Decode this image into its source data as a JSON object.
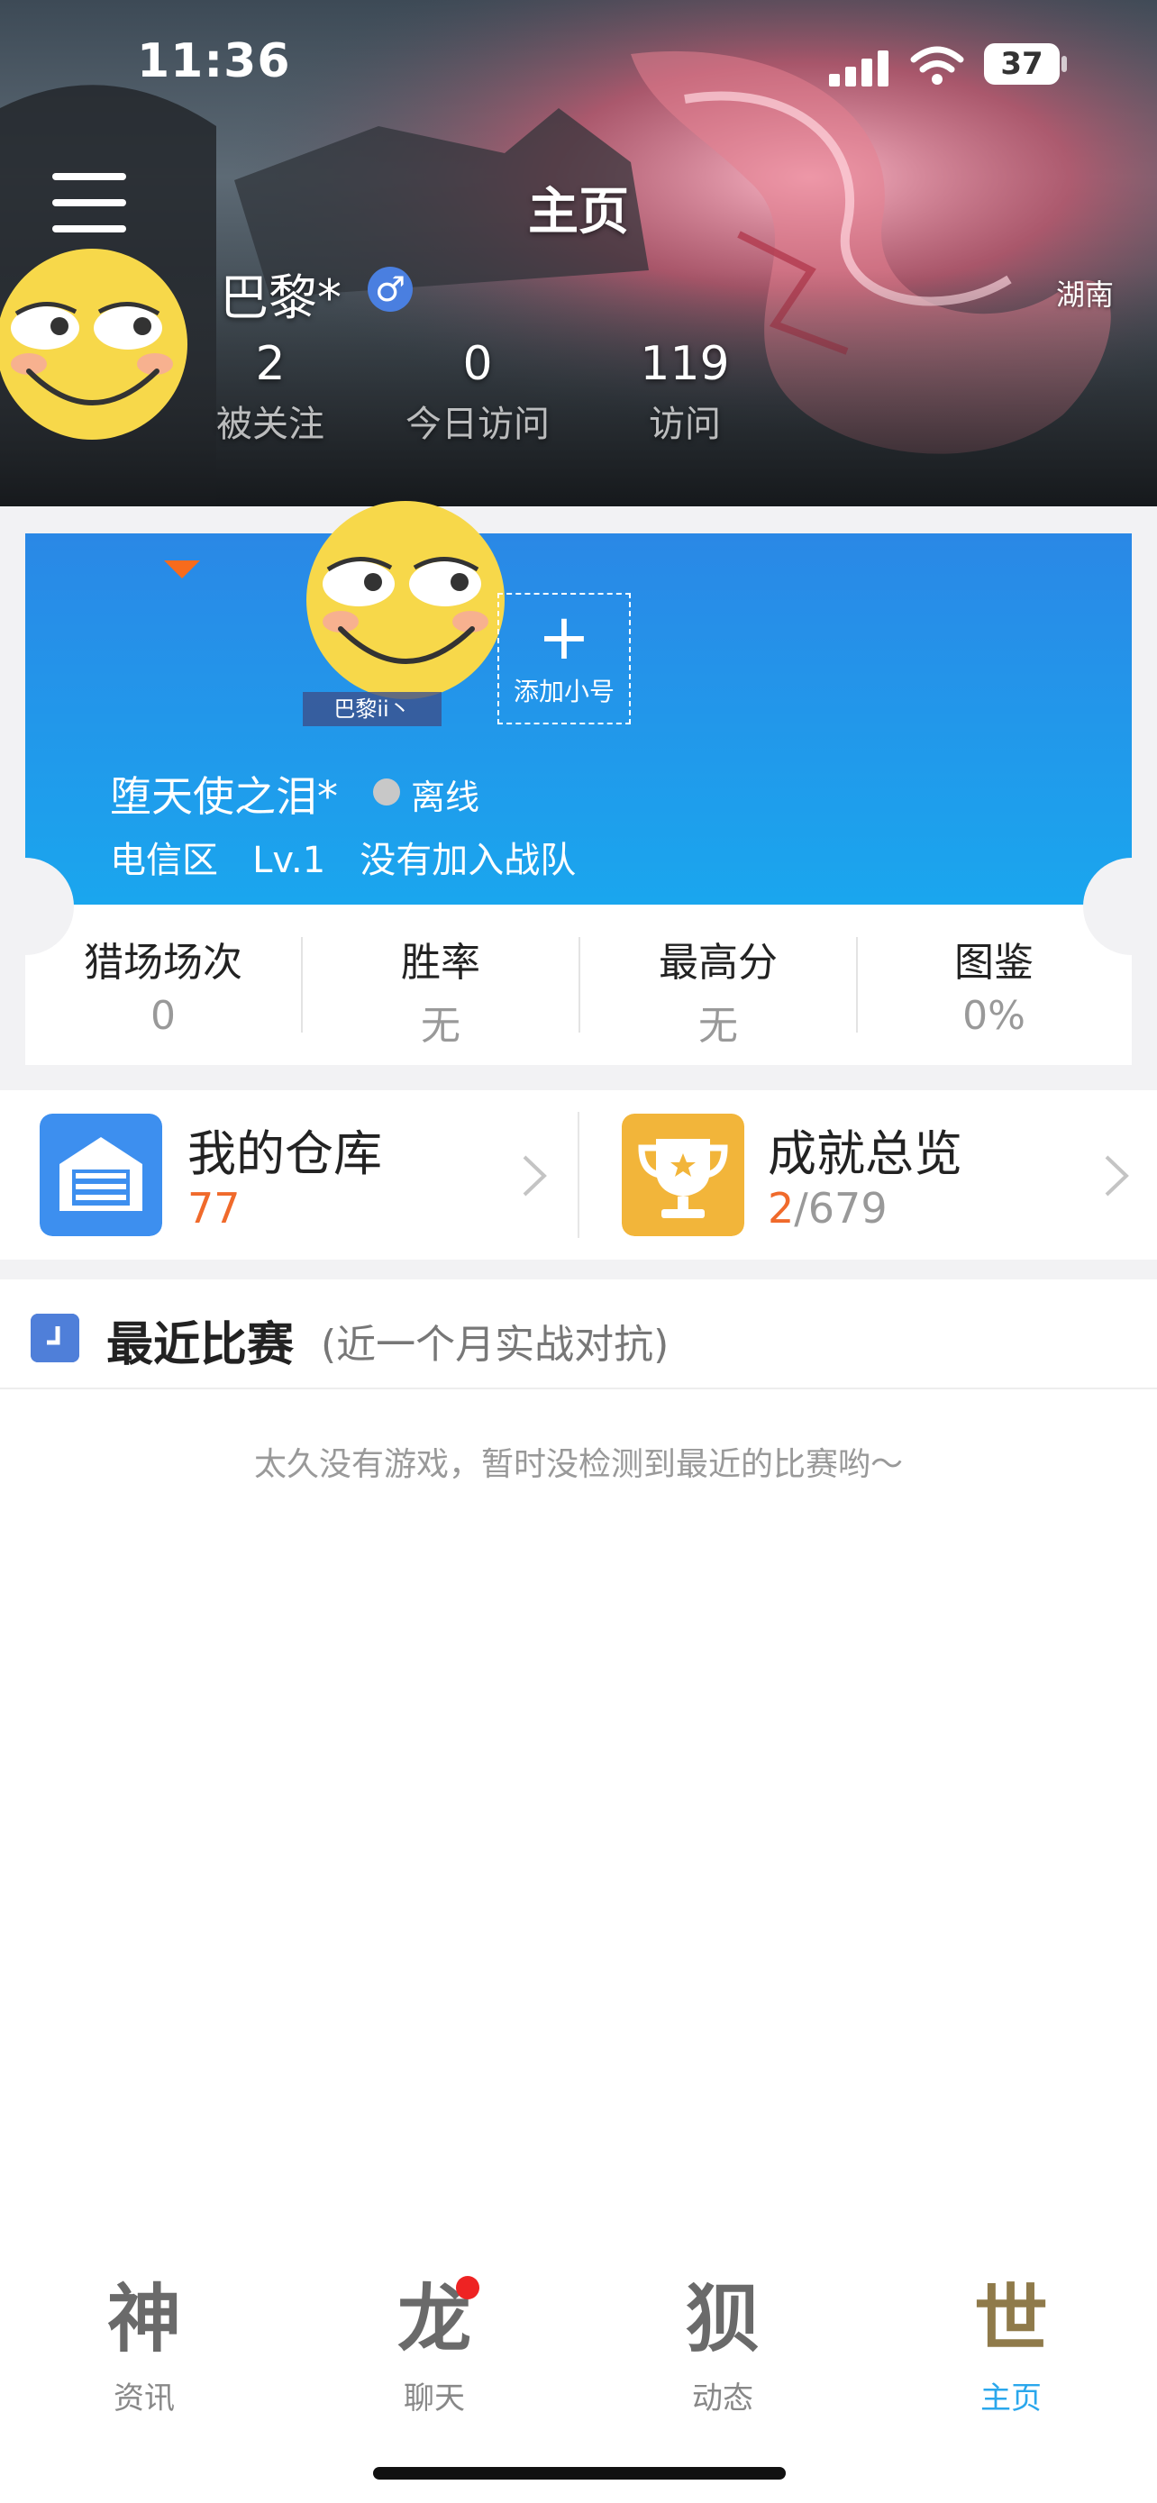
{
  "status_bar": {
    "time": "11:36",
    "battery": "37"
  },
  "header": {
    "title": "主页",
    "username": "巴黎*",
    "gender_symbol": "♂",
    "location": "湖南",
    "stats": [
      {
        "value": "2",
        "label": "被关注"
      },
      {
        "value": "0",
        "label": "今日访问"
      },
      {
        "value": "119",
        "label": "访问"
      }
    ]
  },
  "game_card": {
    "account_tag": "巴黎ii丶",
    "add_account_plus": "+",
    "add_account_label": "添加小号",
    "game_name": "堕天使之泪*",
    "status": "离线",
    "info": "电信区   Lv.1   没有加入战队",
    "stats": [
      {
        "label": "猎场场次",
        "value": "0"
      },
      {
        "label": "胜率",
        "value": "无"
      },
      {
        "label": "最高分",
        "value": "无"
      },
      {
        "label": "图鉴",
        "value": "0%"
      }
    ]
  },
  "quick": {
    "warehouse": {
      "title": "我的仓库",
      "count": "77"
    },
    "achievements": {
      "title": "成就总览",
      "done": "2",
      "total": "/679"
    }
  },
  "recent": {
    "title": "最近比赛",
    "note": "(近一个月实战对抗)",
    "empty": "太久没有游戏，暂时没检测到最近的比赛哟～"
  },
  "tabs": [
    {
      "glyph": "神",
      "label": "资讯",
      "active": false
    },
    {
      "glyph": "龙",
      "label": "聊天",
      "active": false
    },
    {
      "glyph": "狈",
      "label": "动态",
      "active": false
    },
    {
      "glyph": "世",
      "label": "主页",
      "active": true
    }
  ],
  "colors": {
    "card_blue": "#2a88e6",
    "accent_orange": "#f06a2b",
    "active_tab": "#2aa7ec",
    "badge_red": "#ee2323"
  },
  "icons": [
    "menu-icon",
    "male-icon",
    "warehouse-icon",
    "trophy-icon",
    "chevron-right-icon",
    "clock-icon"
  ]
}
